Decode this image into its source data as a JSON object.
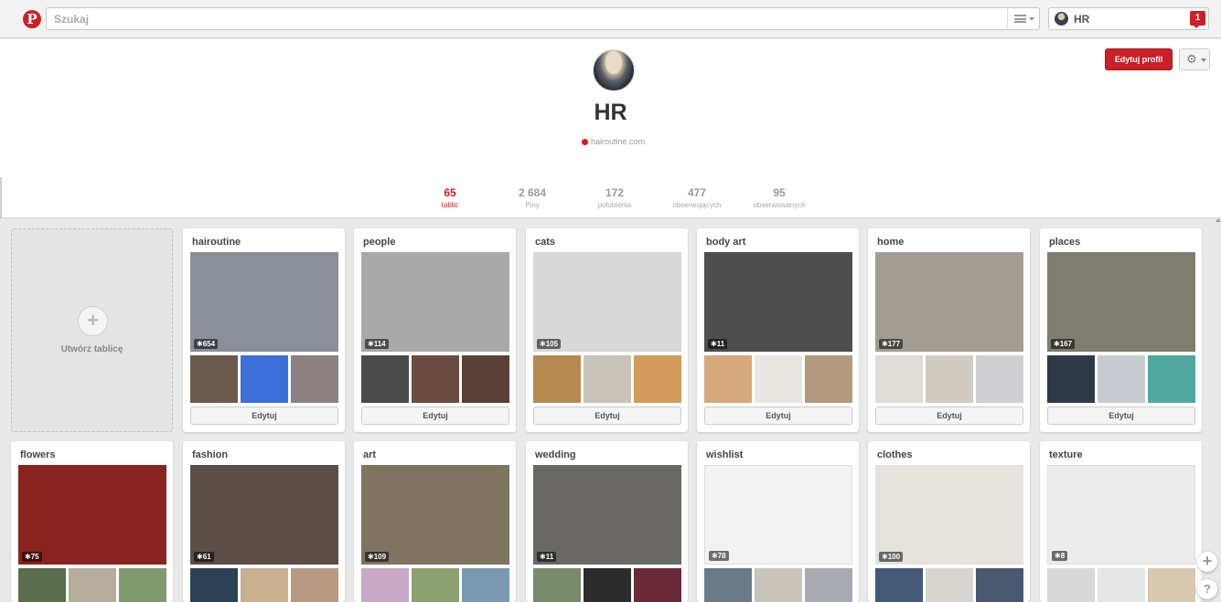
{
  "header": {
    "logo_letter": "P",
    "search_placeholder": "Szukaj",
    "user_name": "HR",
    "notification_count": "1"
  },
  "profile": {
    "name": "HR",
    "website": "hairoutine.com",
    "edit_profile_label": "Edytuj profil",
    "stats": [
      {
        "value": "65",
        "label": "tablic",
        "active": true
      },
      {
        "value": "2 684",
        "label": "Piny"
      },
      {
        "value": "172",
        "label": "polubienia"
      },
      {
        "value": "477",
        "label": "obserwujących"
      },
      {
        "value": "95",
        "label": "obserwowanych"
      }
    ]
  },
  "create_board_label": "Utwórz tablicę",
  "edit_label": "Edytuj",
  "boards": [
    {
      "title": "hairoutine",
      "pins": "654",
      "cover": "#8a8f98",
      "thumbs": [
        "#6a5a4c",
        "#3d6fd8",
        "#8b8180"
      ]
    },
    {
      "title": "people",
      "pins": "114",
      "cover": "#a9a9a9",
      "thumbs": [
        "#4a4a4a",
        "#6a4c40",
        "#5a4036"
      ]
    },
    {
      "title": "cats",
      "pins": "105",
      "cover": "#d8d8d8",
      "thumbs": [
        "#b58a50",
        "#c9c4bb",
        "#d39a5b"
      ]
    },
    {
      "title": "body art",
      "pins": "11",
      "cover": "#4e4e4e",
      "thumbs": [
        "#d7a87c",
        "#e9e5e0",
        "#b39a7e"
      ]
    },
    {
      "title": "home",
      "pins": "177",
      "cover": "#a19d94",
      "thumbs": [
        "#dedcd6",
        "#d2ccc0",
        "#cfcfd2"
      ]
    },
    {
      "title": "places",
      "pins": "167",
      "cover": "#7f7d6f",
      "thumbs": [
        "#2e3a48",
        "#c8ccd0",
        "#4fa8a0"
      ]
    },
    {
      "title": "flowers",
      "pins": "75",
      "cover": "#8a2420",
      "thumbs": [
        "#5b6e4c",
        "#b5ad9c",
        "#7f9a70"
      ]
    },
    {
      "title": "fashion",
      "pins": "61",
      "cover": "#5b4e48",
      "thumbs": [
        "#2e4256",
        "#c9b090",
        "#b89a84"
      ]
    },
    {
      "title": "art",
      "pins": "109",
      "cover": "#7e7460",
      "thumbs": [
        "#c9a8c8",
        "#8ca070",
        "#7a9ab0"
      ]
    },
    {
      "title": "wedding",
      "pins": "11",
      "cover": "#6a6864",
      "thumbs": [
        "#7a8a6a",
        "#2c2c2c",
        "#6a2a3a"
      ]
    },
    {
      "title": "wishlist",
      "pins": "78",
      "cover": "#f2f2f2",
      "thumbs": [
        "#6a7a86",
        "#c8c4bc",
        "#a8aab0"
      ]
    },
    {
      "title": "clothes",
      "pins": "100",
      "cover": "#e6e3de",
      "thumbs": [
        "#445a78",
        "#d8d4d0",
        "#4a5870"
      ]
    },
    {
      "title": "texture",
      "pins": "8",
      "cover": "#ececec",
      "thumbs": [
        "#d8d8d8",
        "#e6e6e6",
        "#d8c8b0"
      ]
    }
  ],
  "float_plus": "+",
  "float_help": "?"
}
